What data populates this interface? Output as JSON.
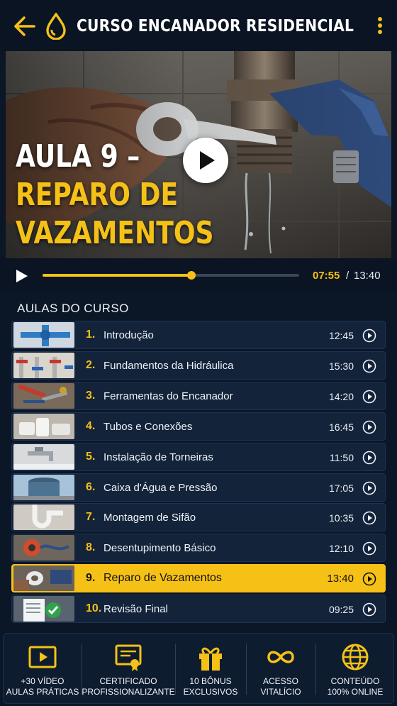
{
  "header": {
    "title": "CURSO ENCANADOR RESIDENCIAL",
    "back_icon": "arrow-left-icon",
    "logo_icon": "water-drop-icon",
    "menu_icon": "kebab-menu-icon"
  },
  "video": {
    "overlay_line1": "AULA 9 –",
    "overlay_line2": "REPARO DE",
    "overlay_line3": "VAZAMENTOS",
    "play_icon": "play-icon"
  },
  "player": {
    "current_time": "07:55",
    "separator": "/",
    "total_time": "13:40",
    "progress": 0.58
  },
  "section": {
    "title": "AULAS DO CURSO"
  },
  "lessons": [
    {
      "number": "1.",
      "title": "Introdução",
      "duration": "12:45",
      "thumb": "blue-pipes"
    },
    {
      "number": "2.",
      "title": "Fundamentos da Hidráulica",
      "duration": "15:30",
      "thumb": "red-blue-valves"
    },
    {
      "number": "3.",
      "title": "Ferramentas do Encanador",
      "duration": "14:20",
      "thumb": "tools"
    },
    {
      "number": "4.",
      "title": "Tubos e Conexões",
      "duration": "16:45",
      "thumb": "pvc-fittings"
    },
    {
      "number": "5.",
      "title": "Instalação de Torneiras",
      "duration": "11:50",
      "thumb": "faucet"
    },
    {
      "number": "6.",
      "title": "Caixa d'Água e Pressão",
      "duration": "17:05",
      "thumb": "water-tank"
    },
    {
      "number": "7.",
      "title": "Montagem de Sifão",
      "duration": "10:35",
      "thumb": "siphon"
    },
    {
      "number": "8.",
      "title": "Desentupimento Básico",
      "duration": "12:10",
      "thumb": "drain-snake"
    },
    {
      "number": "9.",
      "title": "Reparo de Vazamentos",
      "duration": "13:40",
      "thumb": "leak-repair",
      "active": true
    },
    {
      "number": "10.",
      "title": "Revisão Final",
      "duration": "09:25",
      "thumb": "checklist"
    }
  ],
  "features": [
    {
      "icon": "video-play-icon",
      "line1": "+30 VÍDEO",
      "line2": "AULAS PRÁTICAS"
    },
    {
      "icon": "certificate-icon",
      "line1": "CERTIFICADO",
      "line2": "PROFISSIONALIZANTE"
    },
    {
      "icon": "gift-icon",
      "line1": "10 BÔNUS",
      "line2": "EXCLUSIVOS"
    },
    {
      "icon": "infinity-icon",
      "line1": "ACESSO",
      "line2": "VITALÍCIO"
    },
    {
      "icon": "globe-icon",
      "line1": "CONTEÚDO",
      "line2": "100% ONLINE"
    }
  ],
  "colors": {
    "accent": "#f5c116",
    "background": "#0b1626",
    "row": "#13233a"
  }
}
